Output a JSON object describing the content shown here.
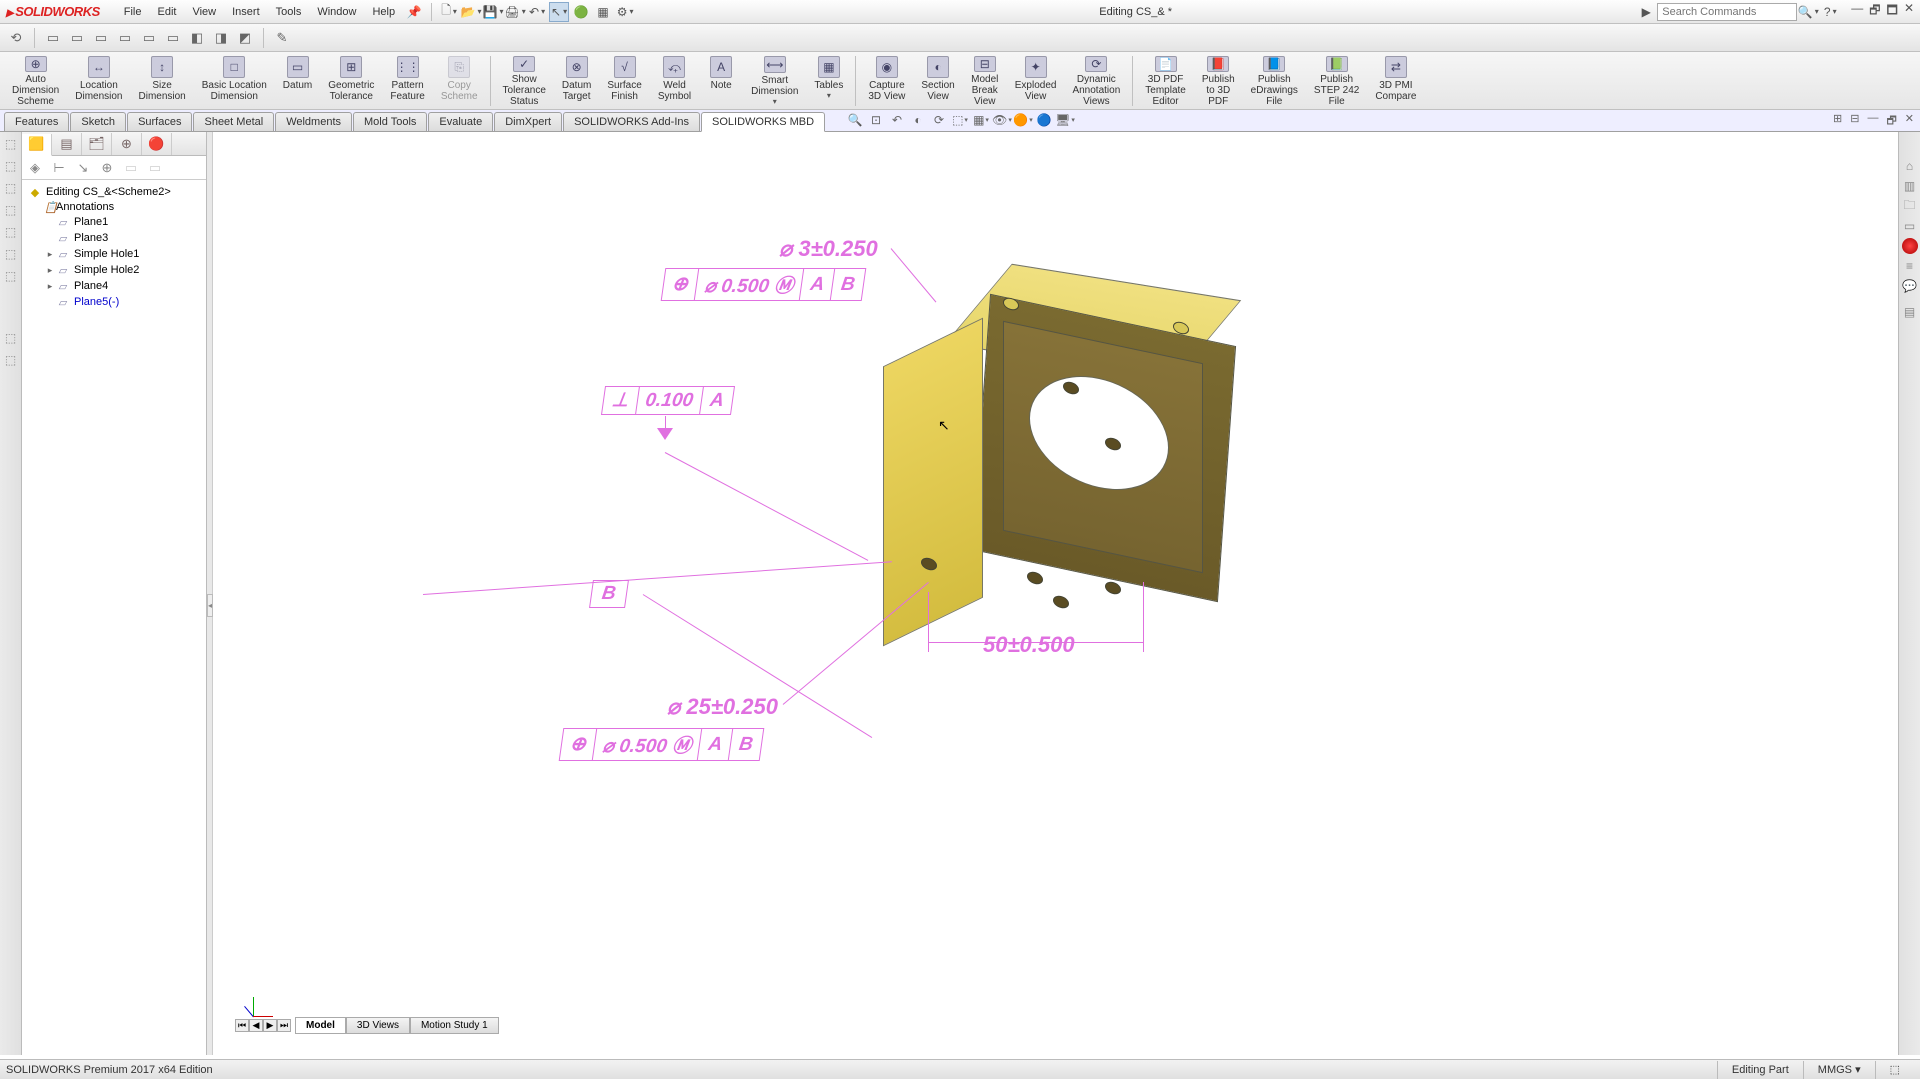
{
  "app": {
    "title": "Editing CS_& *",
    "product_line": "SOLIDWORKS",
    "search_ph": "Search Commands"
  },
  "menus": [
    "File",
    "Edit",
    "View",
    "Insert",
    "Tools",
    "Window",
    "Help"
  ],
  "ribbon": [
    {
      "label": "Auto\nDimension\nScheme",
      "icon": "⊕"
    },
    {
      "label": "Location\nDimension",
      "icon": "↔"
    },
    {
      "label": "Size\nDimension",
      "icon": "↕"
    },
    {
      "label": "Basic Location\nDimension",
      "icon": "□"
    },
    {
      "label": "Datum",
      "icon": "▭"
    },
    {
      "label": "Geometric\nTolerance",
      "icon": "⊞"
    },
    {
      "label": "Pattern\nFeature",
      "icon": "⋮⋮"
    },
    {
      "label": "Copy\nScheme",
      "icon": "⎘",
      "disabled": true
    },
    {
      "label": "Show\nTolerance\nStatus",
      "icon": "✓"
    },
    {
      "label": "Datum\nTarget",
      "icon": "⊗"
    },
    {
      "label": "Surface\nFinish",
      "icon": "√"
    },
    {
      "label": "Weld\nSymbol",
      "icon": "⤽"
    },
    {
      "label": "Note",
      "icon": "A"
    },
    {
      "label": "Smart\nDimension",
      "icon": "⟷",
      "dd": true
    },
    {
      "label": "Tables",
      "icon": "▦",
      "dd": true
    },
    {
      "label": "Capture\n3D View",
      "icon": "◉"
    },
    {
      "label": "Section\nView",
      "icon": "◐"
    },
    {
      "label": "Model\nBreak\nView",
      "icon": "⊟"
    },
    {
      "label": "Exploded\nView",
      "icon": "✦"
    },
    {
      "label": "Dynamic\nAnnotation\nViews",
      "icon": "⟳"
    },
    {
      "label": "3D PDF\nTemplate\nEditor",
      "icon": "📄"
    },
    {
      "label": "Publish\nto 3D\nPDF",
      "icon": "📕"
    },
    {
      "label": "Publish\neDrawings\nFile",
      "icon": "📘"
    },
    {
      "label": "Publish\nSTEP 242\nFile",
      "icon": "📗"
    },
    {
      "label": "3D PMI\nCompare",
      "icon": "⇄"
    }
  ],
  "tabs": [
    "Features",
    "Sketch",
    "Surfaces",
    "Sheet Metal",
    "Weldments",
    "Mold Tools",
    "Evaluate",
    "DimXpert",
    "SOLIDWORKS Add-Ins",
    "SOLIDWORKS MBD"
  ],
  "active_tab": "SOLIDWORKS MBD",
  "tree": {
    "root": "Editing CS_&<Scheme2>",
    "items": [
      {
        "label": "Annotations",
        "icon": "anno",
        "exp": "▸"
      },
      {
        "label": "Plane1",
        "icon": "plane",
        "exp": ""
      },
      {
        "label": "Plane3",
        "icon": "plane",
        "exp": ""
      },
      {
        "label": "Simple Hole1",
        "icon": "plane",
        "exp": "▸"
      },
      {
        "label": "Simple Hole2",
        "icon": "plane",
        "exp": "▸"
      },
      {
        "label": "Plane4",
        "icon": "plane",
        "exp": "▸"
      },
      {
        "label": "Plane5(-)",
        "icon": "plane",
        "exp": "",
        "blue": true
      }
    ]
  },
  "annotations": {
    "dim1": "⌀ 3±0.250",
    "fcf1": {
      "sym": "⊕",
      "tol": "⌀ 0.500 Ⓜ",
      "d1": "A",
      "d2": "B"
    },
    "fcf2": {
      "sym": "⊥",
      "tol": "0.100",
      "d1": "A"
    },
    "datumB": "B",
    "dim2": "⌀ 25±0.250",
    "fcf3": {
      "sym": "⊕",
      "tol": "⌀ 0.500 Ⓜ",
      "d1": "A",
      "d2": "B"
    },
    "dim3": "50±0.500"
  },
  "bottom_tabs": [
    "Model",
    "3D Views",
    "Motion Study 1"
  ],
  "status": {
    "left": "SOLIDWORKS Premium 2017 x64 Edition",
    "mode": "Editing Part",
    "units": "MMGS"
  }
}
